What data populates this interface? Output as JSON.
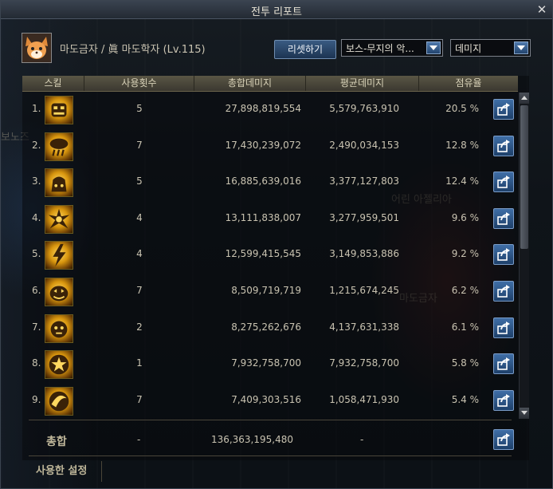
{
  "window": {
    "title": "전투 리포트",
    "close": "✕"
  },
  "character": {
    "name": "마도금자 / 眞 마도학자 (Lv.115)"
  },
  "controls": {
    "reset_label": "리셋하기",
    "boss_select": "보스-무지의 악...",
    "metric_select": "데미지"
  },
  "columns": [
    "스킬",
    "사용횟수",
    "총합데미지",
    "평균데미지",
    "점유율"
  ],
  "skills": [
    {
      "rank": "1.",
      "icon": "pumpkin-face-icon",
      "uses": "5",
      "total": "27,898,819,554",
      "avg": "5,579,763,910",
      "share": "20.5 %"
    },
    {
      "rank": "2.",
      "icon": "storm-cloud-icon",
      "uses": "7",
      "total": "17,430,239,072",
      "avg": "2,490,034,153",
      "share": "12.8 %"
    },
    {
      "rank": "3.",
      "icon": "candy-sack-icon",
      "uses": "5",
      "total": "16,885,639,016",
      "avg": "3,377,127,803",
      "share": "12.4 %"
    },
    {
      "rank": "4.",
      "icon": "spiky-burst-icon",
      "uses": "4",
      "total": "13,111,838,007",
      "avg": "3,277,959,501",
      "share": "9.6 %"
    },
    {
      "rank": "5.",
      "icon": "lightning-strike-icon",
      "uses": "4",
      "total": "12,599,415,545",
      "avg": "3,149,853,886",
      "share": "9.2 %"
    },
    {
      "rank": "6.",
      "icon": "jack-o-lantern-icon",
      "uses": "7",
      "total": "8,509,719,719",
      "avg": "1,215,674,245",
      "share": "6.2 %"
    },
    {
      "rank": "7.",
      "icon": "doll-face-icon",
      "uses": "2",
      "total": "8,275,262,676",
      "avg": "4,137,631,338",
      "share": "6.1 %"
    },
    {
      "rank": "8.",
      "icon": "star-orb-icon",
      "uses": "1",
      "total": "7,932,758,700",
      "avg": "7,932,758,700",
      "share": "5.8 %"
    },
    {
      "rank": "9.",
      "icon": "swirl-orb-icon",
      "uses": "7",
      "total": "7,409,303,516",
      "avg": "1,058,471,930",
      "share": "5.4 %"
    }
  ],
  "total": {
    "label": "총합",
    "uses": "-",
    "total": "136,363,195,480",
    "avg": "-"
  },
  "bottom_tab": "사용한 설정",
  "background_labels": {
    "left": "보노즈",
    "right_top": "어린 아젤리아",
    "right_mid": "마도금자"
  },
  "colors": {
    "accent": "#3f6ea6",
    "header": "#5a5645",
    "icon_gold": "#ffd860"
  }
}
